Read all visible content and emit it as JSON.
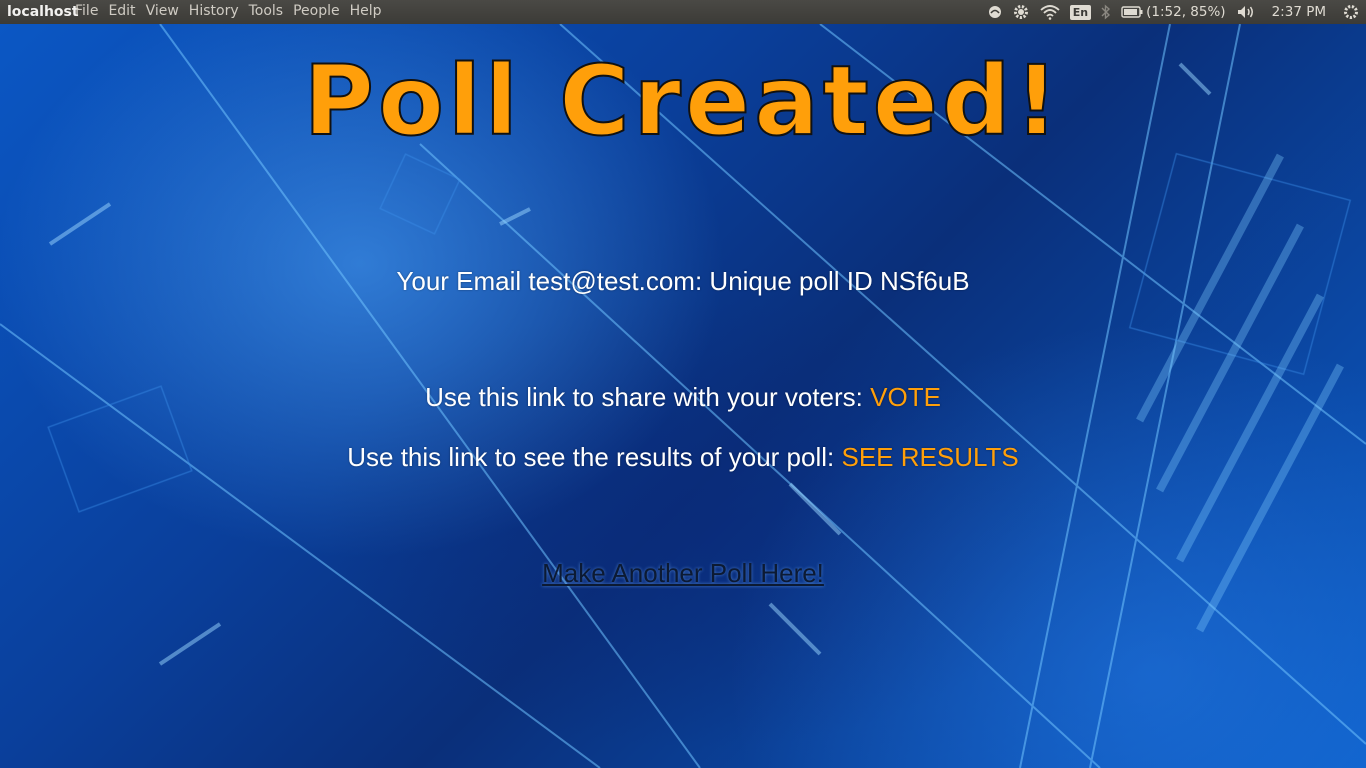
{
  "topbar": {
    "app_title": "localhost",
    "menu": [
      "File",
      "Edit",
      "View",
      "History",
      "Tools",
      "People",
      "Help"
    ],
    "lang": "En",
    "battery": "(1:52, 85%)",
    "clock": "2:37 PM"
  },
  "page": {
    "headline": "Poll Created!",
    "email_text": "Your Email test@test.com: Unique poll ID NSf6uB",
    "vote_prefix": "Use this link to share with your voters:",
    "vote_link": "VOTE",
    "results_prefix": "Use this link to see the results of your poll:",
    "results_link": "SEE RESULTS",
    "another_link": "Make Another Poll Here!"
  },
  "colors": {
    "accent": "#ff9f0a",
    "panel": "#3c3b37",
    "background": "#0a3f9b"
  }
}
